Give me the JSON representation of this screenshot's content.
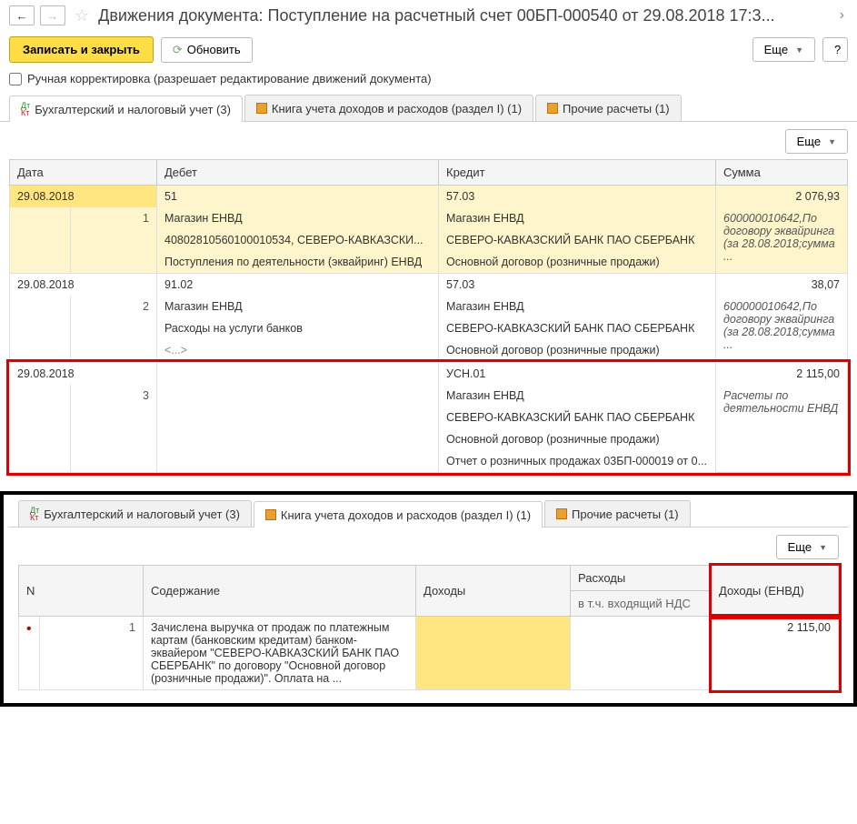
{
  "header": {
    "title": "Движения документа: Поступление на расчетный счет 00БП-000540 от 29.08.2018 17:3..."
  },
  "toolbar": {
    "save_close": "Записать и закрыть",
    "refresh": "Обновить",
    "more": "Еще",
    "help": "?"
  },
  "manual_edit": {
    "label": "Ручная корректировка (разрешает редактирование движений документа)"
  },
  "tabs": [
    {
      "label": "Бухгалтерский и налоговый учет (3)"
    },
    {
      "label": "Книга учета доходов и расходов (раздел I) (1)"
    },
    {
      "label": "Прочие расчеты (1)"
    }
  ],
  "accounting_table": {
    "headers": {
      "date": "Дата",
      "debit": "Дебет",
      "credit": "Кредит",
      "sum": "Сумма"
    },
    "rows": [
      {
        "date": "29.08.2018",
        "n": "1",
        "debit_acc": "51",
        "credit_acc": "57.03",
        "amount": "2 076,93",
        "debit_l1": "Магазин ЕНВД",
        "credit_l1": "Магазин ЕНВД",
        "sum_l1": "600000010642,По договору эквайринга (за 28.08.2018;сумма ...",
        "debit_l2": "40802810560100010534, СЕВЕРО-КАВКАЗСКИ...",
        "credit_l2": "СЕВЕРО-КАВКАЗСКИЙ БАНК ПАО СБЕРБАНК",
        "debit_l3": "Поступления по деятельности (эквайринг) ЕНВД",
        "credit_l3": "Основной договор (розничные продажи)"
      },
      {
        "date": "29.08.2018",
        "n": "2",
        "debit_acc": "91.02",
        "credit_acc": "57.03",
        "amount": "38,07",
        "debit_l1": "Магазин ЕНВД",
        "credit_l1": "Магазин ЕНВД",
        "sum_l1": "600000010642,По договору эквайринга (за 28.08.2018;сумма ...",
        "debit_l2": "Расходы на услуги банков",
        "credit_l2": "СЕВЕРО-КАВКАЗСКИЙ БАНК ПАО СБЕРБАНК",
        "debit_l3": "<...>",
        "credit_l3": "Основной договор (розничные продажи)"
      },
      {
        "date": "29.08.2018",
        "n": "3",
        "debit_acc": "",
        "credit_acc": "УСН.01",
        "amount": "2 115,00",
        "credit_l1": "Магазин ЕНВД",
        "sum_l1": "Расчеты по деятельности ЕНВД",
        "credit_l2": "СЕВЕРО-КАВКАЗСКИЙ БАНК ПАО СБЕРБАНК",
        "credit_l3": "Основной договор (розничные продажи)",
        "credit_l4": "Отчет о розничных продажах 03БП-000019 от 0..."
      }
    ]
  },
  "income_table": {
    "headers": {
      "n": "N",
      "content": "Содержание",
      "income": "Доходы",
      "expense": "Расходы",
      "expense_sub": "в т.ч. входящий НДС",
      "income_envd": "Доходы (ЕНВД)"
    },
    "rows": [
      {
        "n": "1",
        "content": "Зачислена выручка от продаж по платежным картам (банковским кредитам) банком-эквайером \"СЕВЕРО-КАВКАЗСКИЙ БАНК ПАО СБЕРБАНК\" по договору \"Основной договор (розничные продажи)\". Оплата на ...",
        "income": "",
        "expense": "",
        "income_envd": "2 115,00"
      }
    ]
  }
}
